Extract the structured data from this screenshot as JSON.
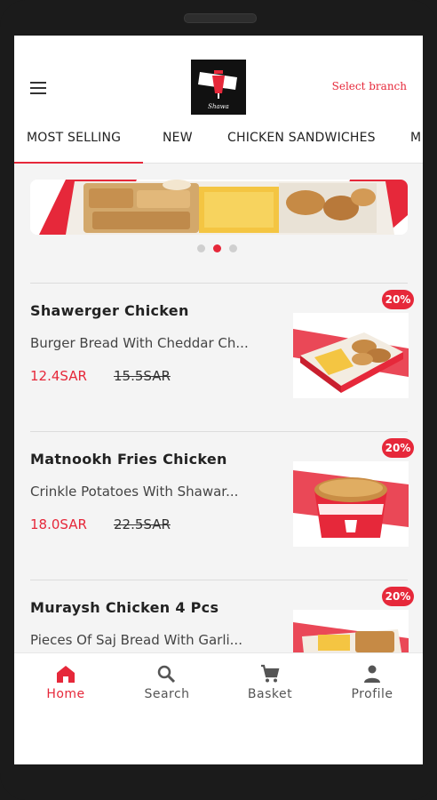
{
  "header": {
    "select_branch": "Select branch"
  },
  "tabs": [
    {
      "label": "MOST SELLING",
      "active": true
    },
    {
      "label": "NEW",
      "active": false
    },
    {
      "label": "CHICKEN SANDWICHES",
      "active": false
    },
    {
      "label": "M",
      "active": false
    }
  ],
  "carousel": {
    "count": 3,
    "active_index": 1
  },
  "colors": {
    "accent": "#e6283a",
    "text": "#222222",
    "muted": "#555555"
  },
  "items": [
    {
      "name": "Shawerger Chicken",
      "description": "Burger Bread With Cheddar Ch...",
      "price": "12.4SAR",
      "old_price": "15.5SAR",
      "discount": "20%"
    },
    {
      "name": "Matnookh Fries Chicken",
      "description": "Crinkle Potatoes With Shawar...",
      "price": "18.0SAR",
      "old_price": "22.5SAR",
      "discount": "20%"
    },
    {
      "name": "Muraysh Chicken 4 Pcs",
      "description": "Pieces Of Saj Bread With Garli...",
      "price": "",
      "old_price": "",
      "discount": "20%"
    }
  ],
  "bottom_nav": [
    {
      "label": "Home",
      "icon": "home-icon",
      "active": true
    },
    {
      "label": "Search",
      "icon": "search-icon",
      "active": false
    },
    {
      "label": "Basket",
      "icon": "cart-icon",
      "active": false
    },
    {
      "label": "Profile",
      "icon": "person-icon",
      "active": false
    }
  ]
}
